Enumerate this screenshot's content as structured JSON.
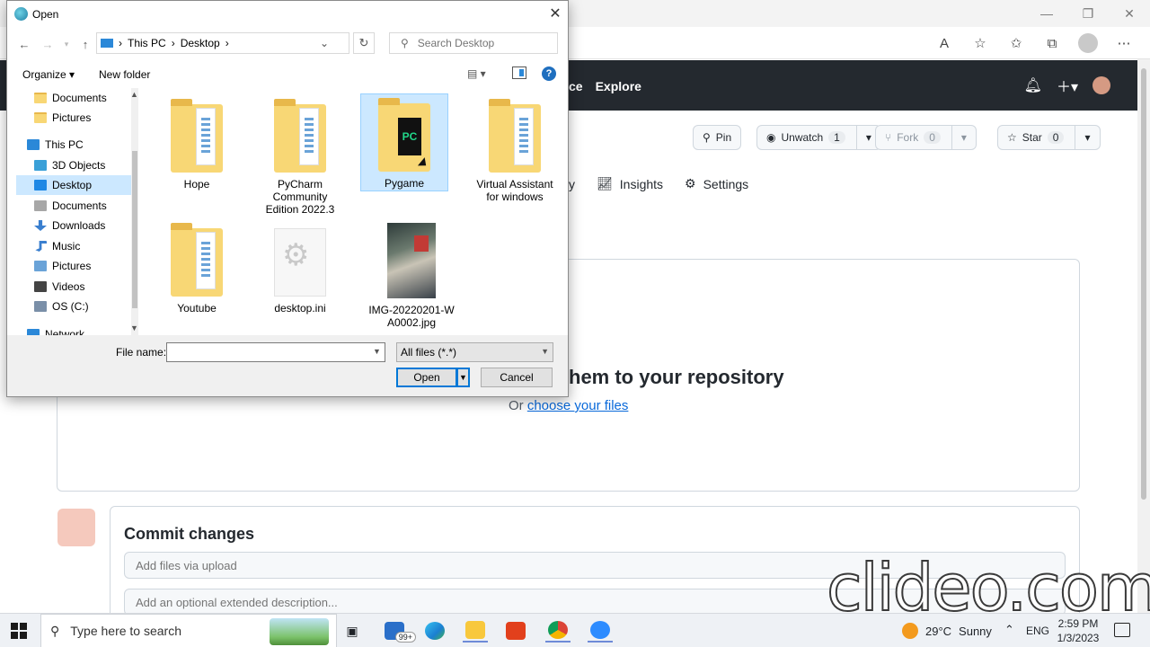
{
  "dialog": {
    "title": "Open",
    "breadcrumb": [
      "This PC",
      "Desktop"
    ],
    "search_placeholder": "Search Desktop",
    "organize_label": "Organize ▾",
    "new_folder_label": "New folder",
    "nav_items": [
      {
        "label": "Documents",
        "icon": "folder-icon"
      },
      {
        "label": "Pictures",
        "icon": "folder-icon"
      },
      {
        "label": "This PC",
        "icon": "computer-icon"
      },
      {
        "label": "3D Objects",
        "icon": "cube-icon"
      },
      {
        "label": "Desktop",
        "icon": "desktop-icon",
        "selected": true
      },
      {
        "label": "Documents",
        "icon": "documents-icon"
      },
      {
        "label": "Downloads",
        "icon": "download-icon"
      },
      {
        "label": "Music",
        "icon": "music-icon"
      },
      {
        "label": "Pictures",
        "icon": "pictures-icon"
      },
      {
        "label": "Videos",
        "icon": "video-icon"
      },
      {
        "label": "OS (C:)",
        "icon": "drive-icon"
      },
      {
        "label": "Network",
        "icon": "network-icon"
      }
    ],
    "files": [
      {
        "name": "Hope",
        "type": "folder"
      },
      {
        "name": "PyCharm Community Edition 2022.3",
        "type": "folder"
      },
      {
        "name": "Pygame",
        "type": "folder",
        "selected": true
      },
      {
        "name": "Virtual Assistant for windows",
        "type": "folder"
      },
      {
        "name": "Youtube",
        "type": "folder"
      },
      {
        "name": "desktop.ini",
        "type": "settings-file"
      },
      {
        "name": "IMG-20220201-WA0002.jpg",
        "type": "image"
      }
    ],
    "file_name_label": "File name:",
    "file_name_value": "",
    "file_type_filter": "All files (*.*)",
    "open_button": "Open",
    "cancel_button": "Cancel"
  },
  "github": {
    "nav": [
      "ce",
      "Explore"
    ],
    "pin_label": "Pin",
    "unwatch_label": "Unwatch",
    "unwatch_count": "1",
    "fork_label": "Fork",
    "fork_count": "0",
    "star_label": "Star",
    "star_count": "0",
    "tabs": [
      "y",
      "Insights",
      "Settings"
    ],
    "drop_title": "hem to your repository",
    "drop_or": "Or",
    "drop_link": "choose your files",
    "commit_title": "Commit changes",
    "commit_summary_placeholder": "Add files via upload",
    "commit_desc_placeholder": "Add an optional extended description..."
  },
  "watermark": "clideo.com",
  "taskbar": {
    "search_placeholder": "Type here to search",
    "mail_badge": "99+",
    "temperature": "29°C",
    "weather": "Sunny",
    "language": "ENG",
    "time": "2:59 PM",
    "date": "1/3/2023"
  }
}
